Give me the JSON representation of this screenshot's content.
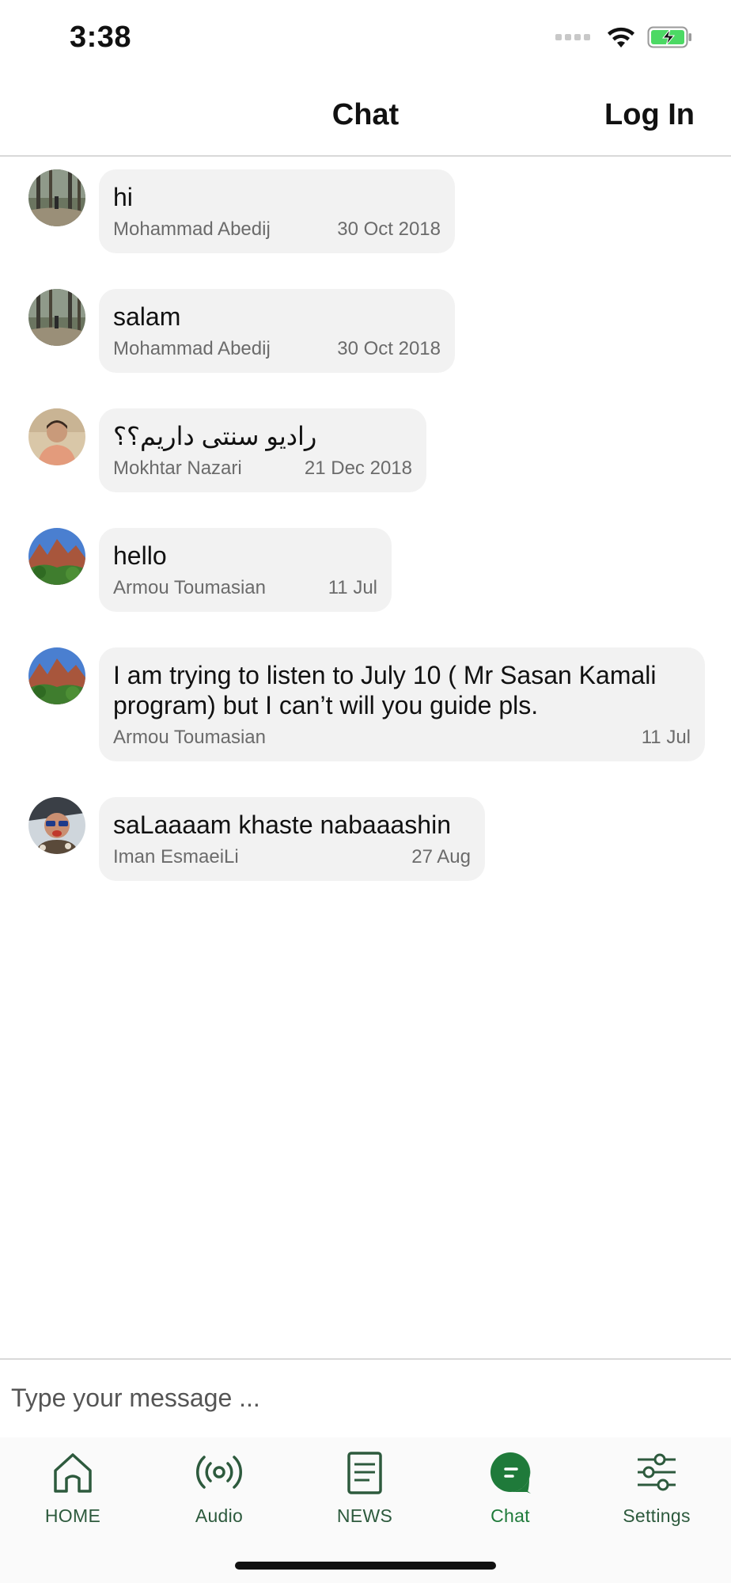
{
  "status_bar": {
    "time": "3:38",
    "icons": [
      "signal-icon",
      "wifi-icon",
      "battery-charging-icon"
    ]
  },
  "header": {
    "title": "Chat",
    "login_label": "Log In"
  },
  "messages": [
    {
      "text": "hi",
      "author": "Mohammad Abedij",
      "date": "30 Oct 2018",
      "avatar": "forest-path-avatar"
    },
    {
      "text": "salam",
      "author": "Mohammad Abedij",
      "date": "30 Oct 2018",
      "avatar": "forest-path-avatar"
    },
    {
      "text": "رادیو سنتی داریم؟؟",
      "author": "Mokhtar Nazari",
      "date": "21 Dec 2018",
      "avatar": "man-portrait-avatar"
    },
    {
      "text": "hello",
      "author": "Armou Toumasian",
      "date": "11 Jul",
      "avatar": "mountain-landscape-avatar"
    },
    {
      "text": "I am trying to listen to July 10 ( Mr Sasan Kamali program) but I can’t will you guide pls.",
      "author": "Armou Toumasian",
      "date": "11 Jul",
      "avatar": "mountain-landscape-avatar"
    },
    {
      "text": "saLaaaam khaste nabaaashin",
      "author": "Iman EsmaeiLi",
      "date": "27 Aug",
      "avatar": "man-sunglasses-avatar"
    }
  ],
  "input": {
    "placeholder": "Type your message ..."
  },
  "tabs": [
    {
      "label": "HOME",
      "icon": "home-icon",
      "active": false
    },
    {
      "label": "Audio",
      "icon": "radio-broadcast-icon",
      "active": false
    },
    {
      "label": "NEWS",
      "icon": "news-document-icon",
      "active": false
    },
    {
      "label": "Chat",
      "icon": "chat-bubble-icon",
      "active": true
    },
    {
      "label": "Settings",
      "icon": "sliders-icon",
      "active": false
    }
  ],
  "colors": {
    "accent": "#1f7a3a",
    "tab_icon": "#2d5a3d",
    "bubble_bg": "#f2f2f2",
    "meta_text": "#6b6b6b"
  }
}
